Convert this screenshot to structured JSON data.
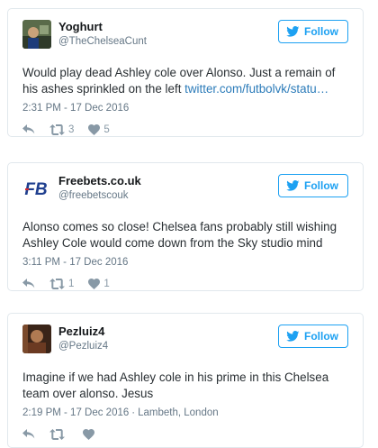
{
  "colors": {
    "accent": "#1da1f2",
    "link": "#2b7bb9",
    "muted": "#657786",
    "icon": "#8899a6"
  },
  "tweets": [
    {
      "display_name": "Yoghurt",
      "handle": "@TheChelseaCunt",
      "follow_label": "Follow",
      "text": "Would play dead Ashley cole over Alonso. Just a remain of his ashes sprinkled on the left ",
      "link": "twitter.com/futbolvk/statu…",
      "time": "2:31 PM - 17 Dec 2016",
      "location": "",
      "retweets": "3",
      "likes": "5"
    },
    {
      "display_name": "Freebets.co.uk",
      "handle": "@freebetscouk",
      "follow_label": "Follow",
      "avatar_text": "FB",
      "text": "Alonso comes so close! Chelsea fans probably still wishing Ashley Cole would come down from the Sky studio mind",
      "time": "3:11 PM - 17 Dec 2016",
      "location": "",
      "retweets": "1",
      "likes": "1"
    },
    {
      "display_name": "Pezluiz4",
      "handle": "@Pezluiz4",
      "follow_label": "Follow",
      "text": "Imagine if we had Ashley cole in his prime in this Chelsea team over alonso. Jesus",
      "time": "2:19 PM - 17 Dec 2016",
      "location": "Lambeth, London",
      "retweets": "",
      "likes": ""
    }
  ]
}
